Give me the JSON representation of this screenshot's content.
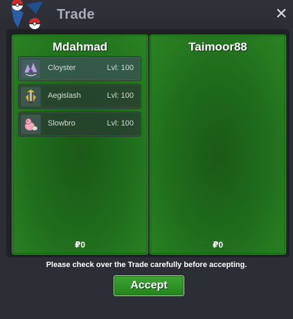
{
  "window": {
    "title": "Trade",
    "close_label": "✕"
  },
  "left_panel": {
    "player_name": "Mdahmad",
    "pokemon": [
      {
        "name": "Cloyster",
        "level": "Lvl: 100",
        "icon": "cloyster-icon"
      },
      {
        "name": "Aegislash",
        "level": "Lvl: 100",
        "icon": "aegislash-icon"
      },
      {
        "name": "Slowbro",
        "level": "Lvl: 100",
        "icon": "slowbro-icon"
      }
    ],
    "money": "₽0"
  },
  "right_panel": {
    "player_name": "Taimoor88",
    "pokemon": [],
    "money": "₽0"
  },
  "notice": "Please check over the Trade carefully before accepting.",
  "accept_label": "Accept",
  "colors": {
    "panel_green": "#1f6a1b",
    "accept_green": "#2f9628",
    "background": "#2b2e34"
  }
}
